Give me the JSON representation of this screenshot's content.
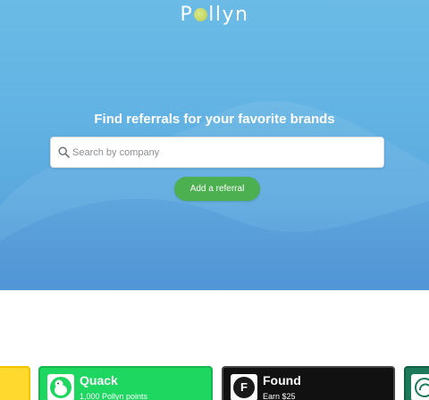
{
  "brand": {
    "logo_left": "P",
    "logo_right": "llyn",
    "logo_o_icon": "avocado-o-icon"
  },
  "hero": {
    "headline": "Find referrals for your favorite brands",
    "search_placeholder": "Search by company",
    "add_button_label": "Add a referral",
    "colors": {
      "top": "#6bbbe6",
      "bottom": "#4b94d6",
      "button": "#4caf50"
    }
  },
  "cards": [
    {
      "title": "Quack",
      "subtitle": "1,000 Pollyn points",
      "color": "#1ed760",
      "icon": "duck-icon"
    },
    {
      "title": "Found",
      "subtitle": "Earn $25",
      "color": "#111111",
      "icon": "f-letter-icon"
    }
  ]
}
